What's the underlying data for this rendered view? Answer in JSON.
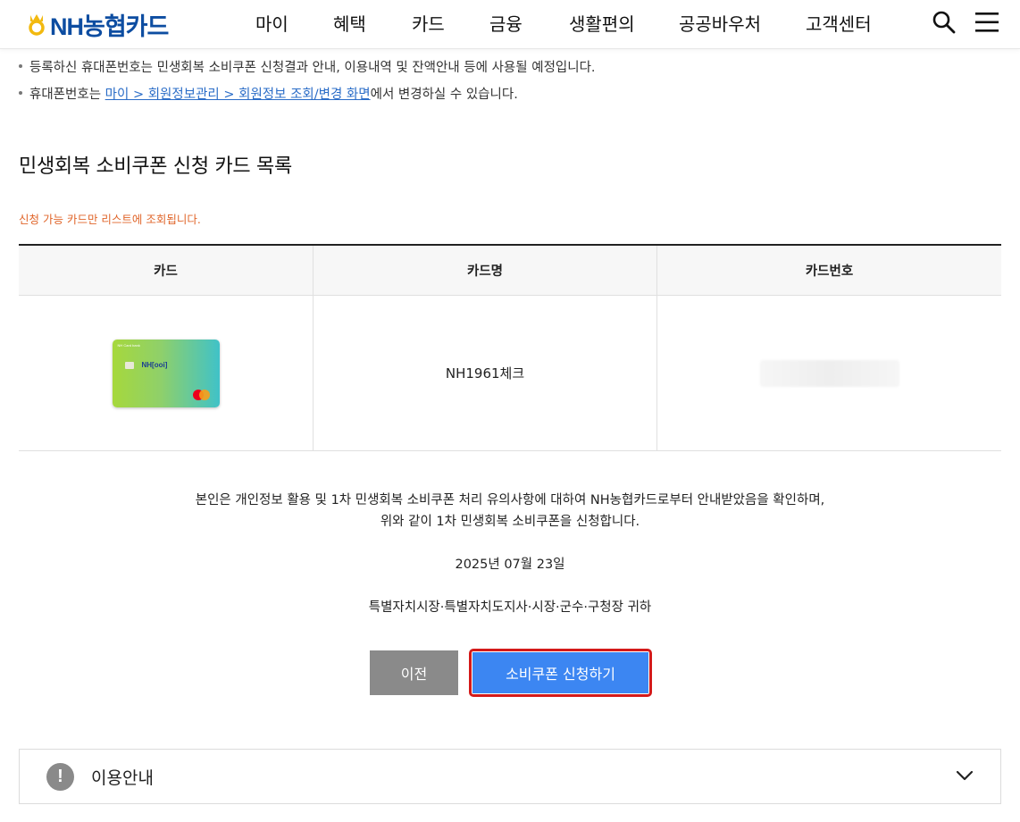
{
  "header": {
    "logo_text": "NH농협카드",
    "nav": [
      "마이",
      "혜택",
      "카드",
      "금융",
      "생활편의",
      "공공바우처",
      "고객센터"
    ]
  },
  "notices": {
    "line1": "등록하신 휴대폰번호는 민생회복 소비쿠폰 신청결과 안내, 이용내역 및 잔액안내 등에 사용될 예정입니다.",
    "line2_prefix": "휴대폰번호는 ",
    "line2_link": "마이 > 회원정보관리 > 회원정보 조회/변경 화면",
    "line2_suffix": "에서 변경하실 수 있습니다."
  },
  "section": {
    "title": "민생회복 소비쿠폰 신청 카드 목록",
    "note": "신청 가능 카드만 리스트에 조회됩니다."
  },
  "table": {
    "headers": [
      "카드",
      "카드명",
      "카드번호"
    ],
    "rows": [
      {
        "card_name": "NH1961체크",
        "card_brand_text": "NH[ooi]",
        "card_top_text": "NH Card bank"
      }
    ]
  },
  "statement": {
    "line1": "본인은 개인정보 활용 및 1차 민생회복 소비쿠폰 처리 유의사항에 대하여 NH농협카드로부터 안내받았음을 확인하며,",
    "line2": "위와 같이 1차 민생회복 소비쿠폰을 신청합니다.",
    "date": "2025년 07월 23일",
    "addressee": "특별자치시장·특별자치도지사·시장·군수·구청장 귀하"
  },
  "buttons": {
    "prev": "이전",
    "apply": "소비쿠폰 신청하기"
  },
  "accordion": {
    "icon_text": "!",
    "label": "이용안내"
  },
  "colors": {
    "brand_blue": "#0d4da1",
    "apply_button": "#3c86f2",
    "highlight_border": "#d41a1a",
    "note_orange": "#e0662b",
    "link_blue": "#2a6cc7"
  }
}
